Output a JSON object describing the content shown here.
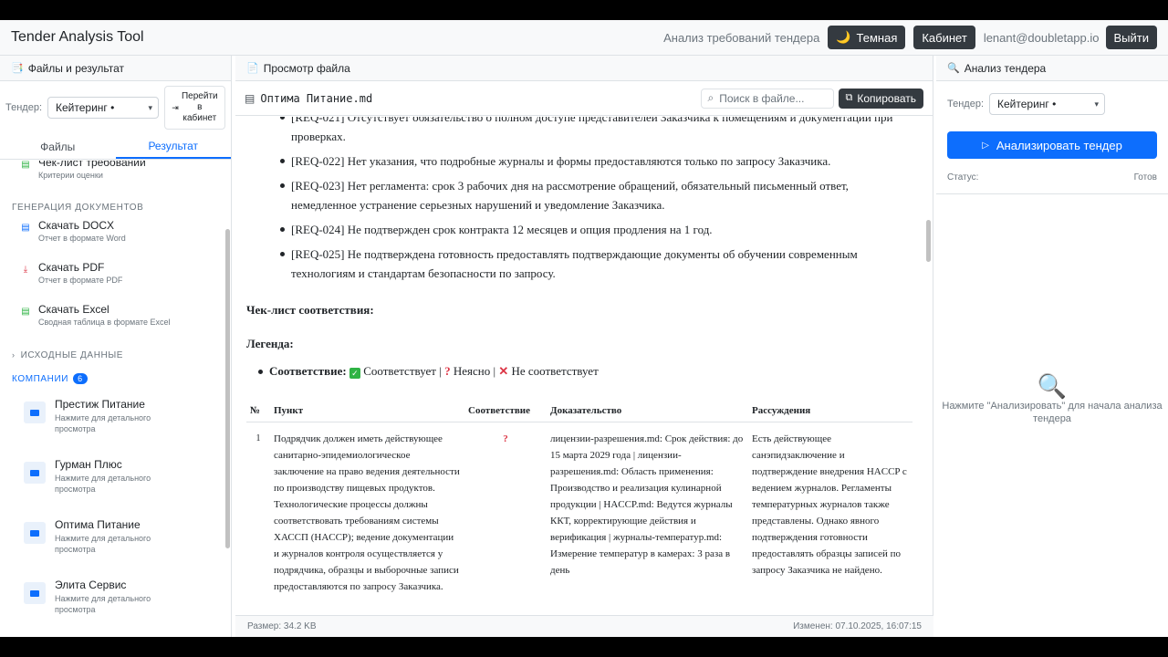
{
  "header": {
    "app_title": "Tender Analysis Tool",
    "subtitle": "Анализ требований тендера",
    "theme_label": "Темная",
    "cabinet_label": "Кабинет",
    "email": "lenant@doubletapp.io",
    "logout_label": "Выйти"
  },
  "left": {
    "title": "Файлы и результат",
    "tender_label": "Тендер:",
    "tender_value": "Кейтеринг •",
    "goto_label": "Перейти в кабинет",
    "tabs": [
      "Файлы",
      "Результат"
    ],
    "active_tab": "Результат",
    "checklist": {
      "title": "Чек-лист требований",
      "sub": "Критерии оценки"
    },
    "gen_section": "ГЕНЕРАЦИЯ ДОКУМЕНТОВ",
    "downloads": [
      {
        "title": "Скачать DOCX",
        "sub": "Отчет в формате Word"
      },
      {
        "title": "Скачать PDF",
        "sub": "Отчет в формате PDF"
      },
      {
        "title": "Скачать Excel",
        "sub": "Сводная таблица в формате Excel"
      }
    ],
    "source_section": "ИСХОДНЫЕ ДАННЫЕ",
    "companies_section": "КОМПАНИИ",
    "companies_count": "6",
    "companies": [
      {
        "title": "Престиж Питание",
        "sub": "Нажмите для детального просмотра"
      },
      {
        "title": "Гурман Плюс",
        "sub": "Нажмите для детального просмотра"
      },
      {
        "title": "Оптима Питание",
        "sub": "Нажмите для детального просмотра"
      },
      {
        "title": "Элита Сервис",
        "sub": "Нажмите для детального просмотра"
      }
    ]
  },
  "middle": {
    "title": "Просмотр файла",
    "file_name": "Оптима Питание.md",
    "search_placeholder": "Поиск в файле...",
    "copy_label": "Копировать",
    "requirements": [
      "[REQ-021] Отсутствует обязательство о полном доступе представителей Заказчика к помещениям и документации при проверках.",
      "[REQ-022] Нет указания, что подробные журналы и формы предоставляются только по запросу Заказчика.",
      "[REQ-023] Нет регламента: срок 3 рабочих дня на рассмотрение обращений, обязательный письменный ответ, немедленное устранение серьезных нарушений и уведомление Заказчика.",
      "[REQ-024] Не подтвержден срок контракта 12 месяцев и опция продления на 1 год.",
      "[REQ-025] Не подтверждена готовность предоставлять подтверждающие документы об обучении современным технологиям и стандартам безопасности по запросу."
    ],
    "checklist_heading": "Чек-лист соответствия:",
    "legend_heading": "Легенда:",
    "legend": {
      "label": "Соответствие:",
      "ok": "Соответствует |",
      "unclear": "Неясно |",
      "bad": "Не соответствует"
    },
    "table": {
      "headers": [
        "№",
        "Пункт",
        "Соответствие",
        "Доказательство",
        "Рассуждения"
      ],
      "rows": [
        {
          "num": "1",
          "item": "Подрядчик должен иметь действующее санитарно-эпидемиологическое заключение на право ведения деятельности по производству пищевых продуктов. Технологические процессы должны соответствовать требованиям системы ХАССП (HACCP); ведение документации и журналов контроля осуществляется у подрядчика, образцы и выборочные записи предоставляются по запросу Заказчика.",
          "status": "?",
          "evidence": "лицензии-разрешения.md: Срок действия: до 15 марта 2029 года | лицензии-разрешения.md: Область применения: Производство и реализация кулинарной продукции | HACCP.md: Ведутся журналы ККТ, корректирующие действия и верификация | журналы-температур.md: Измерение температур в камерах: 3 раза в день",
          "reasoning": "Есть действующее санэпидзаключение и подтверждение внедрения HACCP с ведением журналов. Регламенты температурных журналов также представлены. Однако явного подтверждения готовности предоставлять образцы записей по запросу Заказчика не найдено."
        }
      ]
    },
    "size_text": "Размер: 34.2 KB",
    "modified_text": "Изменен: 07.10.2025, 16:07:15"
  },
  "right": {
    "title": "Анализ тендера",
    "tender_label": "Тендер:",
    "tender_value": "Кейтеринг •",
    "analyze_label": "Анализировать тендер",
    "status_label": "Статус:",
    "status_value": "Готов",
    "empty_text": "Нажмите \"Анализировать\" для начала анализа тендера"
  }
}
